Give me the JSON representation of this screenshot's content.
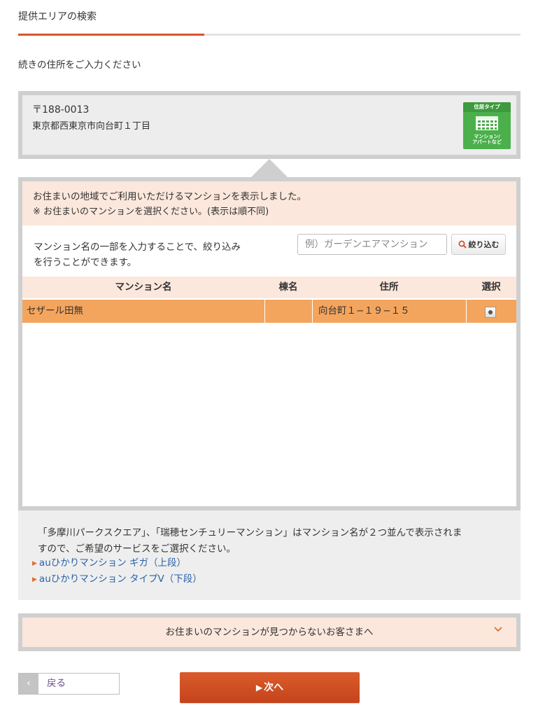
{
  "header": {
    "title": "提供エリアの検索",
    "progress": 0.37
  },
  "instruction": "続きの住所をご入力ください",
  "address": {
    "zip": "〒188-0013",
    "line": "東京都西東京市向台町１丁目",
    "type_badge": {
      "heading": "住居タイプ",
      "label_line1": "マンション/",
      "label_line2": "アパートなど",
      "icon": "building-icon"
    }
  },
  "notice": {
    "line1": "お住まいの地域でご利用いただけるマンションを表示しました。",
    "line2": "※ お住まいのマンションを選択ください。(表示は順不同)"
  },
  "filter": {
    "description_line1": "マンション名の一部を入力することで、絞り込み",
    "description_line2": "を行うことができます。",
    "placeholder": "例）ガーデンエアマンション",
    "value": "",
    "button_label": "絞り込む",
    "button_icon": "search-icon"
  },
  "table": {
    "columns": [
      "マンション名",
      "棟名",
      "住所",
      "選択"
    ],
    "rows": [
      {
        "name": "セザール田無",
        "building": "",
        "address": "向台町１−１９−１５",
        "selected": true
      }
    ]
  },
  "info": {
    "line1": "「多摩川パークスクエア」、「瑞穂センチュリーマンション」はマンション名が２つ並んで表示されま",
    "line2": "すので、ご希望のサービスをご選択ください。",
    "links": [
      "auひかりマンション ギガ（上段）",
      "auひかりマンション タイプV（下段）"
    ]
  },
  "accordion": {
    "label": "お住まいのマンションが見つからないお客さまへ",
    "icon": "chevron-down-icon"
  },
  "nav": {
    "back_label": "戻る",
    "next_label": "次へ"
  },
  "colors": {
    "accent": "#d9542b",
    "selected_row": "#f4a55d",
    "highlight_bg": "#fbe7dc",
    "badge_green": "#4bb04b",
    "link": "#2a62a8"
  }
}
